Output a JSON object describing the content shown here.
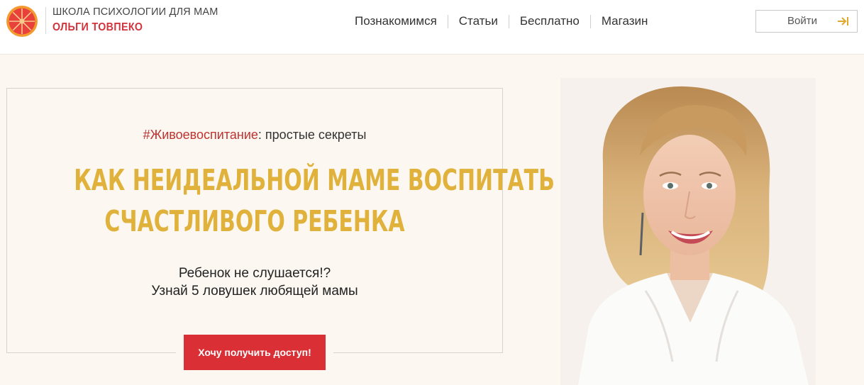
{
  "header": {
    "logo_line1": "ШКОЛА ПСИХОЛОГИИ ДЛЯ МАМ",
    "logo_line2": "ОЛЬГИ ТОВПЕКО",
    "logo_icon": "citrus-slice-icon",
    "nav": [
      "Познакомимся",
      "Статьи",
      "Бесплатно",
      "Магазин"
    ],
    "login_label": "Войти",
    "login_icon": "sign-in-arrow-icon"
  },
  "hero": {
    "tagline_hash": "#Живоевоспитание",
    "tagline_rest": ": простые секреты",
    "headline_line1": "КАК НЕИДЕАЛЬНОЙ МАМЕ ВОСПИТАТЬ",
    "headline_line2": "СЧАСТЛИВОГО РЕБЕНКА",
    "sub_line1": "Ребенок не слушается!?",
    "sub_line2": "Узнай 5 ловушек любящей мамы",
    "cta_label": "Хочу получить доступ!"
  },
  "colors": {
    "brand_red": "#d92f35",
    "headline_gold": "#e0b23b",
    "page_bg": "#fcf8f1",
    "logo_orange": "#f29a2e"
  }
}
